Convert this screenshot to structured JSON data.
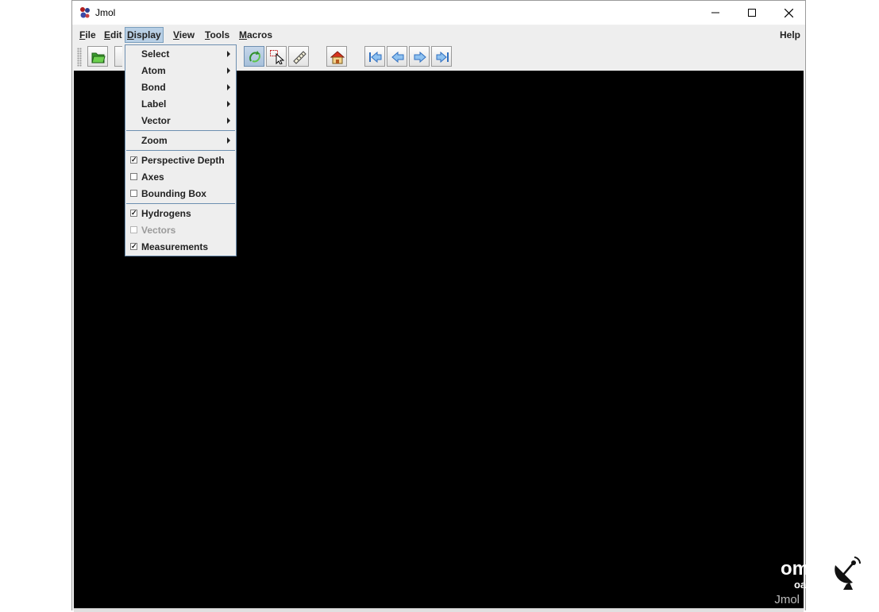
{
  "window": {
    "title": "Jmol"
  },
  "menubar": {
    "items": [
      {
        "label": "File",
        "mnemonic": "F"
      },
      {
        "label": "Edit",
        "mnemonic": "E"
      },
      {
        "label": "Display",
        "mnemonic": "D"
      },
      {
        "label": "View",
        "mnemonic": "V"
      },
      {
        "label": "Tools",
        "mnemonic": "T"
      },
      {
        "label": "Macros",
        "mnemonic": "M"
      }
    ],
    "help": "Help"
  },
  "display_menu": {
    "submenus": [
      "Select",
      "Atom",
      "Bond",
      "Label",
      "Vector",
      "Zoom"
    ],
    "toggles": [
      {
        "label": "Perspective Depth",
        "checked": true,
        "enabled": true
      },
      {
        "label": "Axes",
        "checked": false,
        "enabled": true
      },
      {
        "label": "Bounding Box",
        "checked": false,
        "enabled": true
      },
      {
        "label": "Hydrogens",
        "checked": true,
        "enabled": true
      },
      {
        "label": "Vectors",
        "checked": false,
        "enabled": false
      },
      {
        "label": "Measurements",
        "checked": true,
        "enabled": true
      }
    ]
  },
  "toolbar": {
    "buttons": [
      "open-icon",
      "rotate-icon",
      "select-pointer-icon",
      "ruler-icon",
      "home-icon",
      "first-frame-icon",
      "previous-frame-icon",
      "next-frame-icon",
      "last-frame-icon"
    ],
    "selected": "rotate-icon"
  },
  "canvas": {
    "label": "Jmol",
    "background": "#000000"
  },
  "watermark": {
    "line1": "om",
    "line2": "oads"
  },
  "colors": {
    "menu_highlight": "#b8cfe5",
    "menu_border": "#6d8fb0"
  }
}
